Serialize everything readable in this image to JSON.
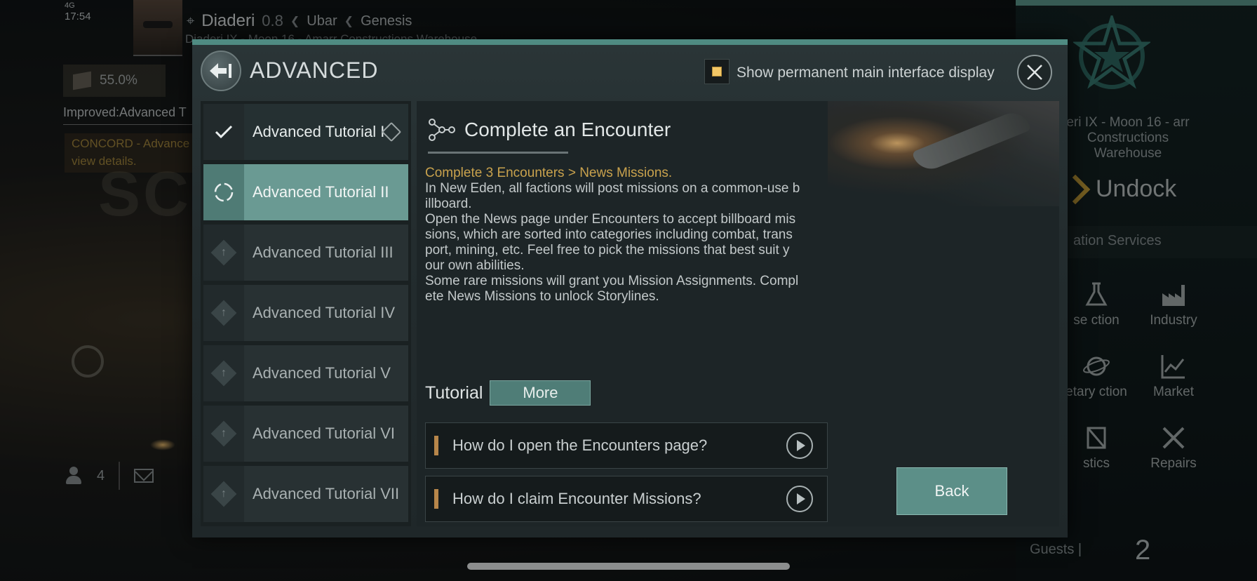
{
  "status": {
    "network": "4G",
    "time": "17:54"
  },
  "location": {
    "system": "Diaderi",
    "security": "0.8",
    "constellation": "Ubar",
    "region": "Genesis",
    "station": "Diaderi IX - Moon 16 - Amarr Constructions Warehouse"
  },
  "hud": {
    "cargo_percent": "55.0%",
    "improved_text": "Improved:Advanced T",
    "concord_text": "CONCORD - Advance view details.",
    "bg_text": "SC",
    "crew_count": "4"
  },
  "station_panel": {
    "station_name": "eri IX - Moon 16 - arr Constructions Warehouse",
    "undock": "Undock",
    "services_header": "ation Services",
    "services": [
      {
        "label": "se ction",
        "icon": "flask-icon"
      },
      {
        "label": "Industry",
        "icon": "factory-icon"
      },
      {
        "label": "etary ction",
        "icon": "planet-icon"
      },
      {
        "label": "Market",
        "icon": "chart-icon"
      },
      {
        "label": "stics",
        "icon": "logistics-icon"
      },
      {
        "label": "Repairs",
        "icon": "wrench-icon"
      }
    ],
    "guests_label": "Guests |",
    "guests_count": "2"
  },
  "modal": {
    "title": "ADVANCED",
    "permanent_display_label": "Show permanent main interface display",
    "permanent_display_checked": true,
    "tutorials": [
      {
        "label": "Advanced Tutorial I",
        "status": "completed"
      },
      {
        "label": "Advanced Tutorial II",
        "status": "in-progress"
      },
      {
        "label": "Advanced Tutorial III",
        "status": "locked"
      },
      {
        "label": "Advanced Tutorial IV",
        "status": "locked"
      },
      {
        "label": "Advanced Tutorial V",
        "status": "locked"
      },
      {
        "label": "Advanced Tutorial VI",
        "status": "locked"
      },
      {
        "label": "Advanced Tutorial VII",
        "status": "locked"
      }
    ],
    "detail": {
      "title": "Complete an Encounter",
      "goal": "Complete 3 Encounters > News Missions.",
      "body": "In New Eden, all factions will post missions on a common-use b\nillboard.\nOpen the News page under Encounters to accept billboard mis\nsions, which are sorted into categories including combat, trans\nport, mining, etc. Feel free to pick the missions that best suit y\nour own abilities.\nSome rare missions will grant you Mission Assignments. Compl\nete News Missions to unlock Storylines.",
      "tutorial_label": "Tutorial",
      "more_label": "More",
      "faqs": [
        "How do I open the Encounters page?",
        "How do I claim Encounter Missions?"
      ],
      "back_label": "Back"
    }
  }
}
